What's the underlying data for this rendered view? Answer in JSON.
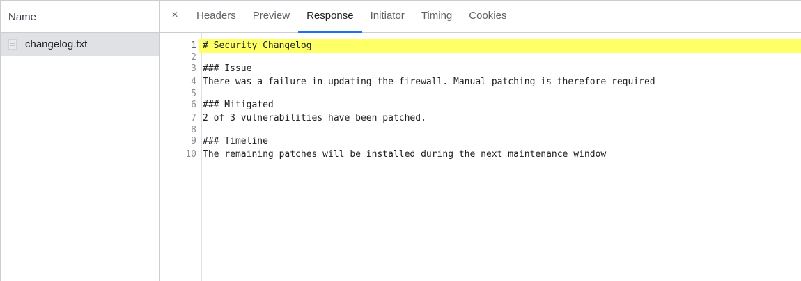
{
  "left_panel": {
    "header": "Name",
    "file_name": "changelog.txt"
  },
  "tabs": {
    "close_glyph": "×",
    "items": [
      "Headers",
      "Preview",
      "Response",
      "Initiator",
      "Timing",
      "Cookies"
    ],
    "active_index": 2
  },
  "editor": {
    "highlighted_line": 1,
    "lines": [
      {
        "num": "1",
        "text": "# Security Changelog"
      },
      {
        "num": "2",
        "text": ""
      },
      {
        "num": "3",
        "text": "### Issue"
      },
      {
        "num": "4",
        "text": "There was a failure in updating the firewall. Manual patching is therefore required"
      },
      {
        "num": "5",
        "text": ""
      },
      {
        "num": "6",
        "text": "### Mitigated"
      },
      {
        "num": "7",
        "text": "2 of 3 vulnerabilities have been patched."
      },
      {
        "num": "8",
        "text": ""
      },
      {
        "num": "9",
        "text": "### Timeline"
      },
      {
        "num": "10",
        "text": "The remaining patches will be installed during the next maintenance window"
      }
    ]
  },
  "colors": {
    "active_tab_underline": "#1a73e8",
    "selected_file_row": "#dfe1e5",
    "line_highlight": "#ffff66"
  }
}
